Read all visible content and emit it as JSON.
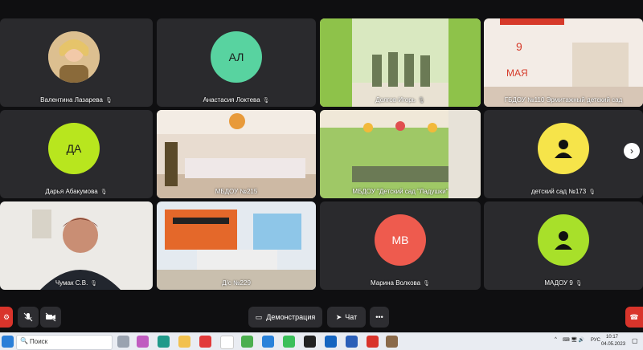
{
  "tiles": [
    {
      "id": "t1",
      "name": "Валентина Лазарева",
      "type": "photo-avatar"
    },
    {
      "id": "t2",
      "name": "Анастасия Локтева",
      "initials": "АЛ",
      "color": "#58d3a0"
    },
    {
      "id": "t3",
      "name": "Долгов Игорь",
      "type": "video",
      "active": true
    },
    {
      "id": "t4",
      "name": "ГБДОУ №110 Эрмитажный детский сад",
      "type": "video"
    },
    {
      "id": "t5",
      "name": "Дарья Абакумова",
      "initials": "ДА",
      "color": "#b8e61e"
    },
    {
      "id": "t6",
      "name": "МБДОУ №215",
      "type": "video"
    },
    {
      "id": "t7",
      "name": "МБДОУ \"Детский сад \"Ладушки\"",
      "type": "video"
    },
    {
      "id": "t8",
      "name": "детский сад №173",
      "type": "icon-avatar",
      "color": "#f6e44a"
    },
    {
      "id": "t9",
      "name": "Чумак С.В.",
      "type": "video"
    },
    {
      "id": "t10",
      "name": "Д/с №229",
      "type": "video"
    },
    {
      "id": "t11",
      "name": "Марина Волкова",
      "initials": "МВ",
      "color": "#ee5b4e"
    },
    {
      "id": "t12",
      "name": "МАДОУ 9",
      "type": "icon-avatar",
      "color": "#a8e02a"
    }
  ],
  "toolbar": {
    "demo_label": "Демонстрация",
    "chat_label": "Чат",
    "more_label": "•••"
  },
  "taskbar": {
    "search_placeholder": "Поиск",
    "lang": "РУС",
    "time": "10:17",
    "date": "04.05.2023"
  },
  "colors": {
    "active_border": "#f5d000",
    "end_call": "#d9342b",
    "tile_bg": "#2a2a2d"
  }
}
